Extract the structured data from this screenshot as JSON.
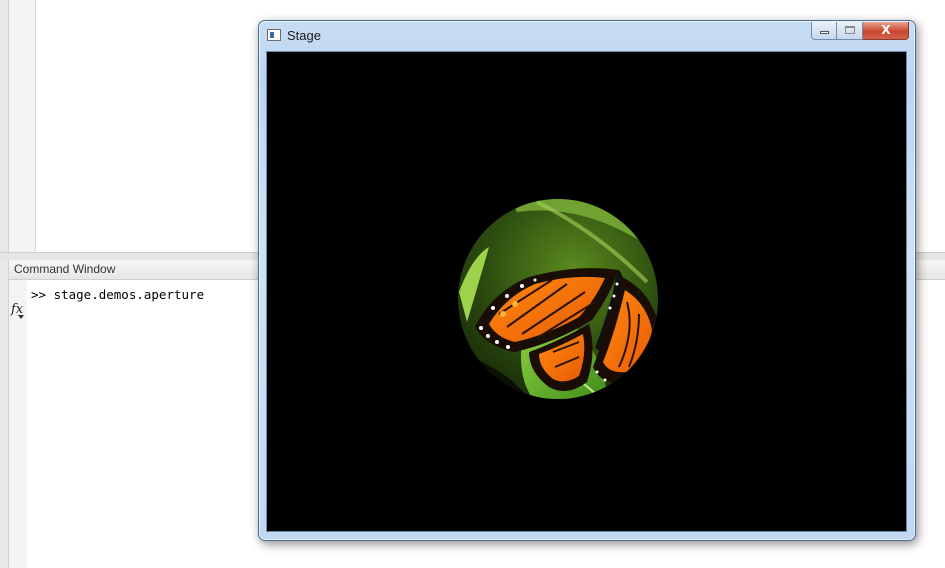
{
  "command_window": {
    "title": "Command Window",
    "fx_label": "fx",
    "lines": [
      ">> stage.demos.aperture"
    ]
  },
  "stage_window": {
    "title": "Stage",
    "close_glyph": "X",
    "image": {
      "subject": "monarch butterfly on a green leaf",
      "mask": "circular aperture on black background"
    }
  },
  "colors": {
    "stage_background": "#000000",
    "titlebar_blue": "#c7ddf3",
    "close_red": "#c8472d"
  }
}
